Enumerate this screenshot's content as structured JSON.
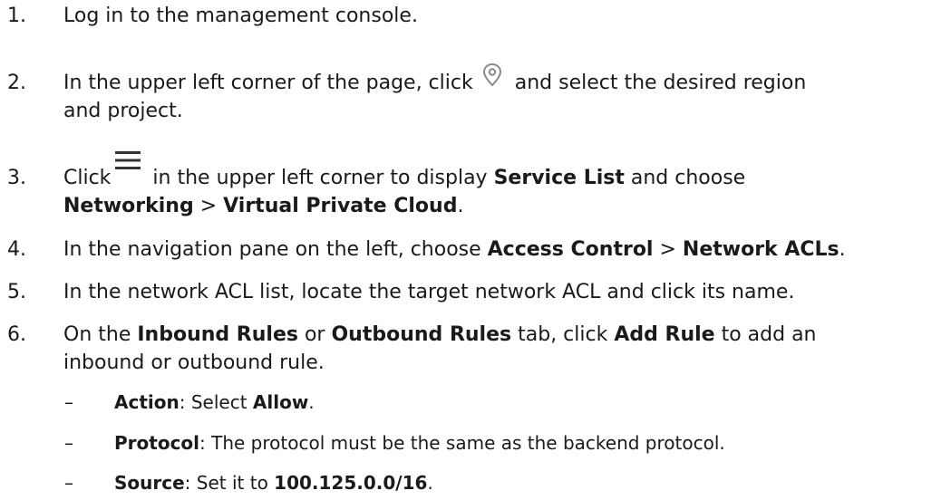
{
  "steps": [
    {
      "num": "1.",
      "parts": [
        "Log in to the management console."
      ]
    },
    {
      "num": "2.",
      "pre": "In the upper left corner of the page, click",
      "post": "and select the desired region",
      "line2": "and project.",
      "icon": "location-pin-icon"
    },
    {
      "num": "3.",
      "pre": "Click",
      "post_a": "in the upper left corner to display",
      "bold_a": "Service List",
      "post_b": "and choose",
      "line2_bold_a": "Networking",
      "line2_sep": ">",
      "line2_bold_b": "Virtual Private Cloud",
      "line2_end": ".",
      "icon": "hamburger-menu-icon"
    },
    {
      "num": "4.",
      "pre": "In the navigation pane on the left, choose",
      "bold_a": "Access Control",
      "sep": ">",
      "bold_b": "Network ACLs",
      "end": "."
    },
    {
      "num": "5.",
      "text": "In the network ACL list, locate the target network ACL and click its name."
    },
    {
      "num": "6.",
      "pre": "On the",
      "bold_a": "Inbound Rules",
      "mid_a": "or",
      "bold_b": "Outbound Rules",
      "mid_b": "tab, click",
      "bold_c": "Add Rule",
      "post": "to add an",
      "line2": "inbound or outbound rule."
    }
  ],
  "substeps": [
    {
      "dash": "–",
      "label": "Action",
      "sep": ": Select",
      "value": "Allow",
      "end": "."
    },
    {
      "dash": "–",
      "label": "Protocol",
      "text": ": The protocol must be the same as the backend protocol."
    },
    {
      "dash": "–",
      "label": "Source",
      "sep": ": Set it to",
      "value": "100.125.0.0/16",
      "end": "."
    }
  ]
}
